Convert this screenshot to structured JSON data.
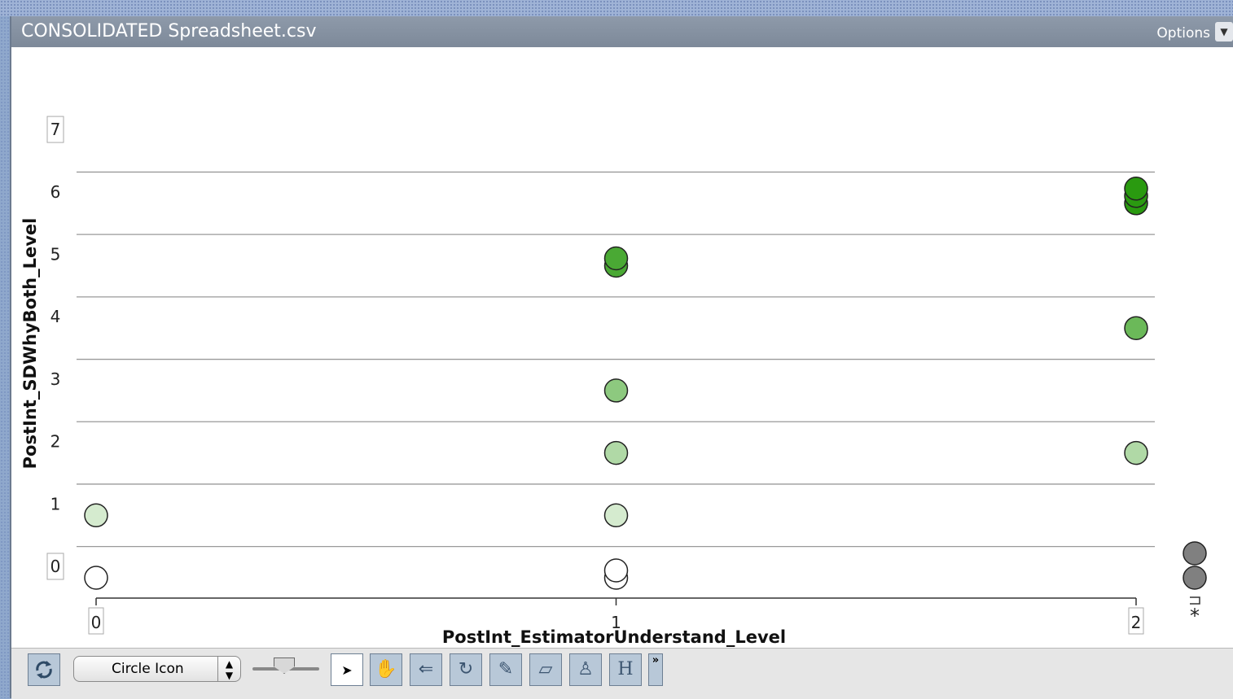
{
  "window": {
    "title": "CONSOLIDATED Spreadsheet.csv",
    "options_label": "Options"
  },
  "toolbar": {
    "icon_select_value": "Circle Icon",
    "tools": [
      "refresh-icon",
      "arrow-select-icon",
      "hand-icon",
      "back-arrow-icon",
      "add-point-icon",
      "pencil-icon",
      "eraser-icon",
      "brush-icon",
      "hat-icon"
    ],
    "more_label": "»"
  },
  "chart_data": {
    "type": "scatter",
    "xlabel": "PostInt_EstimatorUnderstand_Level",
    "ylabel": "PostInt_SDWhyBoth_Level",
    "xlim": [
      0,
      2
    ],
    "ylim": [
      0,
      7
    ],
    "x_ticks": [
      "0",
      "1",
      "2"
    ],
    "y_ticks": [
      "0",
      "1",
      "2",
      "3",
      "4",
      "5",
      "6",
      "7"
    ],
    "boxed_ticks": [
      "0",
      "7"
    ],
    "grid": true,
    "color_scale": {
      "low": "#ffffff",
      "high": "#2a9a10",
      "missing": "#808080"
    },
    "points": [
      {
        "x": 0,
        "y": 0
      },
      {
        "x": 0,
        "y": 1
      },
      {
        "x": 1,
        "y": 0
      },
      {
        "x": 1,
        "y": 0
      },
      {
        "x": 1,
        "y": 1
      },
      {
        "x": 1,
        "y": 2
      },
      {
        "x": 1,
        "y": 3
      },
      {
        "x": 1,
        "y": 5
      },
      {
        "x": 1,
        "y": 5
      },
      {
        "x": 2,
        "y": 2
      },
      {
        "x": 2,
        "y": 4
      },
      {
        "x": 2,
        "y": 6
      },
      {
        "x": 2,
        "y": 6
      },
      {
        "x": 2,
        "y": 6
      }
    ],
    "missing_points": {
      "count": 2,
      "label": "*"
    }
  }
}
